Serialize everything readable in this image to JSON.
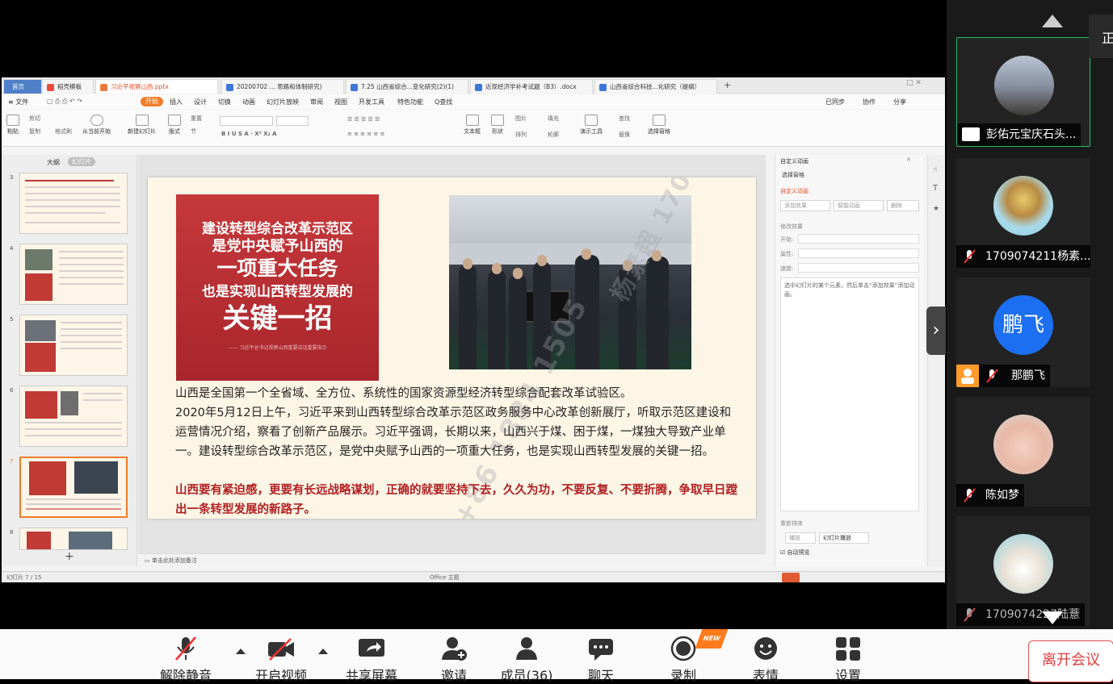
{
  "wps": {
    "tabs": [
      {
        "label": "首页"
      },
      {
        "label": "稻壳模板"
      },
      {
        "label": "习近平视察山西.pptx"
      },
      {
        "label": "20200702 ... 思路和体制研究)"
      },
      {
        "label": "7.25 山西省综合...变化研究(2)(1)"
      },
      {
        "label": "近现经济学补考试题（B3）.docx"
      },
      {
        "label": "山西省综合科技...化研究（提纲）"
      }
    ],
    "add_tab": "+",
    "menus": [
      "≡ 文件",
      "开始",
      "插入",
      "设计",
      "切换",
      "动画",
      "幻灯片放映",
      "审阅",
      "视图",
      "开发工具",
      "特色功能",
      "Q查找"
    ],
    "menu_right": [
      "已同步",
      "协作",
      "分享"
    ],
    "ribbon": {
      "paste": "粘贴",
      "cut": "剪切",
      "copy": "复制",
      "format_painter": "格式刷",
      "play_from_current": "从当前开始",
      "new_slide": "新建幻灯片",
      "layout": "版式",
      "section": "节",
      "reset": "重置",
      "textbox": "文本框",
      "shape": "形状",
      "picture": "图片",
      "arrange": "排列",
      "fill": "填充",
      "outline": "轮廓",
      "present_tool": "演示工具",
      "find": "查找",
      "replace": "替换",
      "select_pane": "选择窗格"
    },
    "outline_tabs": [
      "大纲",
      "幻灯片"
    ],
    "thumb_numbers": [
      "3",
      "4",
      "5",
      "6",
      "7",
      "8"
    ],
    "notes_placeholder": "单击此处添加备注",
    "statusbar": [
      "幻灯片 7 / 15",
      "Office 主题"
    ],
    "custom_anim": {
      "title": "自定义动画",
      "select_pane": "选择窗格",
      "section": "自定义动画",
      "add_effect": "添加效果",
      "smart_anim": "智能动画",
      "delete": "删除",
      "modify": "修改效果",
      "start": "开始:",
      "property": "属性:",
      "speed": "速度:",
      "hint": "选中幻灯片的某个元素，然后单击“添加效果”添加动画。",
      "reorder": "重新排序",
      "play": "播放",
      "slideshow": "幻灯片播放",
      "autopreview": "自动预览"
    }
  },
  "slide": {
    "red_title": [
      "建设转型综合改革示范区",
      "是党中央赋予山西的",
      "一项重大任务",
      "也是实现山西转型发展的",
      "关键一招"
    ],
    "red_source": "—— 习近平总书记视察山西重要讲话重要指示",
    "paragraph1": "山西是全国第一个全省域、全方位、系统性的国家资源型经济转型综合配套改革试验区。",
    "paragraph2": "2020年5月12日上午，习近平来到山西转型综合改革示范区政务服务中心改革创新展厅，听取示范区建设和运营情况介绍，察看了创新产品展示。习近平强调，长期以来，山西兴于煤、困于煤，一煤独大导致产业单一。建设转型综合改革示范区，是党中央赋予山西的一项重大任务，也是实现山西转型发展的关键一招。",
    "paragraph3": "山西要有紧迫感，更要有长远战略谋划，正确的就要坚持下去，久久为功，不要反复、不要折腾，争取早日蹚出一条转型发展的新路子。",
    "watermark": "杨素超 1709074211",
    "watermark_num": "+86 1884 1505"
  },
  "participants": [
    {
      "name": "彭佑元宝庆石头...",
      "mic": "on",
      "sharing": true
    },
    {
      "name": "1709074211杨素...",
      "mic": "off"
    },
    {
      "name": "那鹏飞",
      "mic": "off",
      "avatar_text": "鹏飞",
      "host": true
    },
    {
      "name": "陈如梦",
      "mic": "off"
    },
    {
      "name": "1709074227陆薏",
      "mic": "off"
    }
  ],
  "corner_label": "正",
  "toolbar": {
    "unmute": "解除静音",
    "start_video": "开启视频",
    "share_screen": "共享屏幕",
    "invite": "邀请",
    "members": "成员(36)",
    "chat": "聊天",
    "record": "录制",
    "emoji": "表情",
    "settings": "设置",
    "leave": "离开会议",
    "new_badge": "NEW"
  },
  "colors": {
    "accent_orange": "#f07c2b",
    "slide_red": "#b11f22",
    "active_speaker": "#2dbb6e",
    "leave_red": "#e03c3c",
    "host_badge": "#ff9b2b"
  }
}
